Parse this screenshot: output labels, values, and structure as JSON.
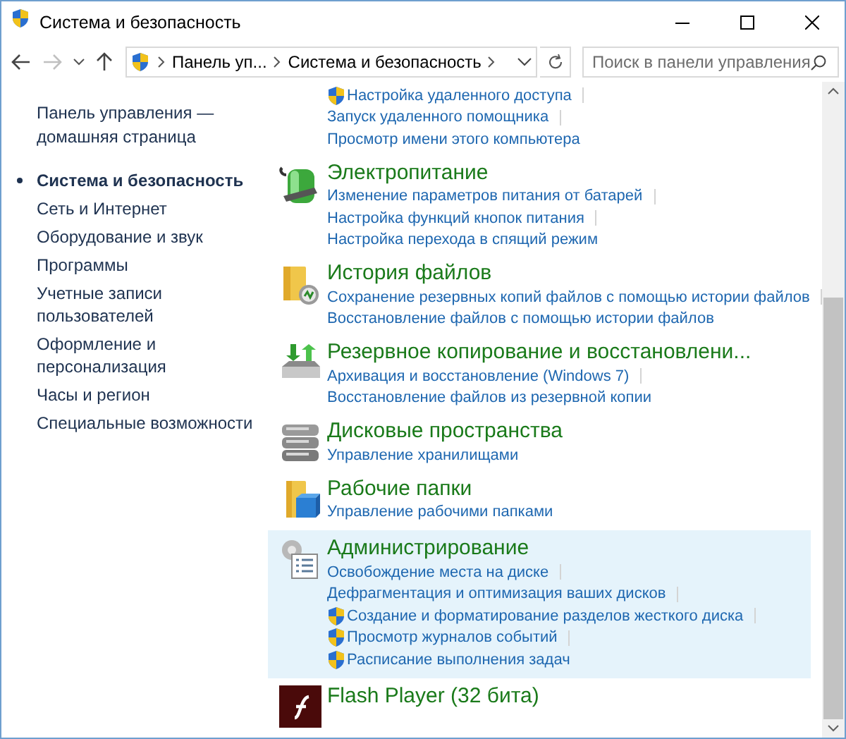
{
  "window": {
    "title": "Система и безопасность"
  },
  "nav": {
    "back_disabled": false,
    "forward_disabled": true,
    "path": [
      "Панель уп...",
      "Система и безопасность"
    ],
    "search": {
      "placeholder": "Поиск в панели управления"
    }
  },
  "sidebar": {
    "home": "Панель управления — домашняя страница",
    "items": [
      {
        "label": "Система и безопасность",
        "selected": true
      },
      {
        "label": "Сеть и Интернет",
        "selected": false
      },
      {
        "label": "Оборудование и звук",
        "selected": false
      },
      {
        "label": "Программы",
        "selected": false
      },
      {
        "label": "Учетные записи пользователей",
        "selected": false
      },
      {
        "label": "Оформление и персонализация",
        "selected": false
      },
      {
        "label": "Часы и регион",
        "selected": false
      },
      {
        "label": "Специальные возможности",
        "selected": false
      }
    ]
  },
  "sections": [
    {
      "kind": "links",
      "selected": false,
      "links": [
        {
          "text": "Настройка удаленного доступа",
          "shield": true
        },
        {
          "text": "Запуск удаленного помощника",
          "shield": false
        },
        {
          "text": "Просмотр имени этого компьютера",
          "shield": false
        }
      ]
    },
    {
      "kind": "power",
      "title": "Электропитание",
      "selected": false,
      "links": [
        {
          "text": "Изменение параметров питания от батарей",
          "shield": false
        },
        {
          "text": "Настройка функций кнопок питания",
          "shield": false
        },
        {
          "text": "Настройка перехода в спящий режим",
          "shield": false
        }
      ]
    },
    {
      "kind": "file-history",
      "title": "История файлов",
      "selected": false,
      "links": [
        {
          "text": "Сохранение резервных копий файлов с помощью истории файлов",
          "shield": false
        },
        {
          "text": "Восстановление файлов с помощью истории файлов",
          "shield": false
        }
      ]
    },
    {
      "kind": "backup",
      "title": "Резервное копирование и восстановлени...",
      "selected": false,
      "links": [
        {
          "text": "Архивация и восстановление (Windows 7)",
          "shield": false
        },
        {
          "text": "Восстановление файлов из резервной копии",
          "shield": false
        }
      ]
    },
    {
      "kind": "storage",
      "title": "Дисковые пространства",
      "selected": false,
      "links": [
        {
          "text": "Управление хранилищами",
          "shield": false
        }
      ]
    },
    {
      "kind": "work-folders",
      "title": "Рабочие папки",
      "selected": false,
      "links": [
        {
          "text": "Управление рабочими папками",
          "shield": false
        }
      ]
    },
    {
      "kind": "admin",
      "title": "Администрирование",
      "selected": true,
      "links": [
        {
          "text": "Освобождение места на диске",
          "shield": false
        },
        {
          "text": "Дефрагментация и оптимизация ваших дисков",
          "shield": false
        },
        {
          "text": "Создание и форматирование разделов жесткого диска",
          "shield": true
        },
        {
          "text": "Просмотр журналов событий",
          "shield": true
        },
        {
          "text": "Расписание выполнения задач",
          "shield": true
        }
      ]
    },
    {
      "kind": "flash",
      "title": "Flash Player (32 бита)",
      "selected": false
    }
  ]
}
